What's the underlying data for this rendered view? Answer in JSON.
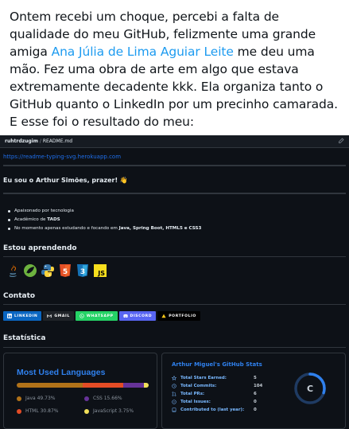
{
  "post": {
    "text_part1": "Ontem recebi um choque, percebi a falta de qualidade do meu GitHub, felizmente uma grande amiga ",
    "mention": "Ana Júlia de Lima Aguiar Leite",
    "text_part2": " me deu uma mão. Fez uma obra de arte em algo que estava extremamente decadente kkk. Ela organiza tanto o GitHub quanto o LinkedIn por um precinho camarada. E esse foi o resultado do meu:"
  },
  "readme": {
    "path_user": "ruhtrdzugim",
    "path_sep": " / ",
    "path_file": "README.md",
    "typing_link": "https://readme-typing-svg.herokuapp.com",
    "intro_heading": "Eu sou o Arthur Simões, prazer! 👋",
    "bullets": [
      {
        "pre": "Apaixonado por tecnologia",
        "bold": "",
        "post": ""
      },
      {
        "pre": "Acadêmico de ",
        "bold": "TADS",
        "post": ""
      },
      {
        "pre": "No momento apenas estudando e focando em ",
        "bold": "Java, Spring Boot, HTML5 e CSS3",
        "post": ""
      }
    ],
    "section_learning": "Estou aprendendo",
    "tech_icons": [
      "java-icon",
      "spring-icon",
      "python-icon",
      "html5-icon",
      "css3-icon",
      "javascript-icon"
    ],
    "tech_js_label": "JS",
    "tech_html_label": "5",
    "tech_css_label": "3",
    "section_contact": "Contato",
    "badges": [
      {
        "label": "LINKEDIN",
        "color": "#0a66c2",
        "icon": "linkedin-icon",
        "glyph": "in"
      },
      {
        "label": "GMAIL",
        "color": "#1f2328",
        "icon": "gmail-icon",
        "glyph": "M"
      },
      {
        "label": "WHATSAPP",
        "color": "#25d366",
        "icon": "whatsapp-icon",
        "glyph": "✆"
      },
      {
        "label": "DISCORD",
        "color": "#5865f2",
        "icon": "discord-icon",
        "glyph": "◉"
      },
      {
        "label": "PORTFOLIO",
        "color": "#000000",
        "icon": "portfolio-icon",
        "glyph": "▲"
      }
    ],
    "section_stats": "Estatística"
  },
  "languages_card": {
    "title": "Most Used Languages",
    "languages": [
      {
        "name": "Java",
        "percent": 49.73,
        "label": "Java 49.73%",
        "color": "#b07219"
      },
      {
        "name": "HTML",
        "percent": 30.87,
        "label": "HTML 30.87%",
        "color": "#e34c26"
      },
      {
        "name": "CSS",
        "percent": 15.66,
        "label": "CSS 15.66%",
        "color": "#663399"
      },
      {
        "name": "JavaScript",
        "percent": 3.75,
        "label": "JavaScript 3.75%",
        "color": "#f1e05a"
      }
    ]
  },
  "stats_card": {
    "title": "Arthur Miguel's GitHub Stats",
    "rows": [
      {
        "label": "Total Stars Earned:",
        "value": "5",
        "icon": "star-icon"
      },
      {
        "label": "Total Commits:",
        "value": "104",
        "icon": "clock-icon"
      },
      {
        "label": "Total PRs:",
        "value": "6",
        "icon": "pull-request-icon"
      },
      {
        "label": "Total Issues:",
        "value": "0",
        "icon": "issue-icon"
      },
      {
        "label": "Contributed to (last year):",
        "value": "0",
        "icon": "repo-icon"
      }
    ],
    "rank": "C",
    "rank_progress": 0.3,
    "accent": "#2f80ed"
  }
}
